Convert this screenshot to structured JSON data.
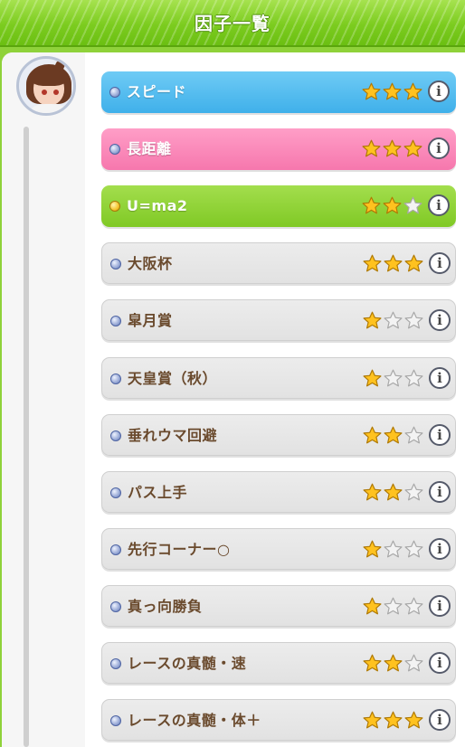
{
  "header": {
    "title": "因子一覧"
  },
  "character": {
    "avatar_icon": "horse-girl-portrait"
  },
  "colors": {
    "blue": "#3fb0ea",
    "pink": "#f677ad",
    "green": "#80c925",
    "gray": "#e2e2e2",
    "star_filled": "#ffc21f",
    "star_empty": "#f3f3f3"
  },
  "factors": [
    {
      "label": "スピード",
      "type": "blue",
      "stars": 3,
      "max_stars": 3,
      "info": "i"
    },
    {
      "label": "長距離",
      "type": "pink",
      "stars": 3,
      "max_stars": 3,
      "info": "i"
    },
    {
      "label": "U=ma2",
      "type": "green",
      "stars": 2,
      "max_stars": 3,
      "info": "i"
    },
    {
      "label": "大阪杯",
      "type": "gray",
      "stars": 3,
      "max_stars": 3,
      "info": "i"
    },
    {
      "label": "皐月賞",
      "type": "gray",
      "stars": 1,
      "max_stars": 3,
      "info": "i"
    },
    {
      "label": "天皇賞（秋）",
      "type": "gray",
      "stars": 1,
      "max_stars": 3,
      "info": "i"
    },
    {
      "label": "垂れウマ回避",
      "type": "gray",
      "stars": 2,
      "max_stars": 3,
      "info": "i"
    },
    {
      "label": "パス上手",
      "type": "gray",
      "stars": 2,
      "max_stars": 3,
      "info": "i"
    },
    {
      "label": "先行コーナー○",
      "type": "gray",
      "stars": 1,
      "max_stars": 3,
      "info": "i"
    },
    {
      "label": "真っ向勝負",
      "type": "gray",
      "stars": 1,
      "max_stars": 3,
      "info": "i"
    },
    {
      "label": "レースの真髄・速",
      "type": "gray",
      "stars": 2,
      "max_stars": 3,
      "info": "i"
    },
    {
      "label": "レースの真髄・体＋",
      "type": "gray",
      "stars": 3,
      "max_stars": 3,
      "info": "i"
    }
  ]
}
